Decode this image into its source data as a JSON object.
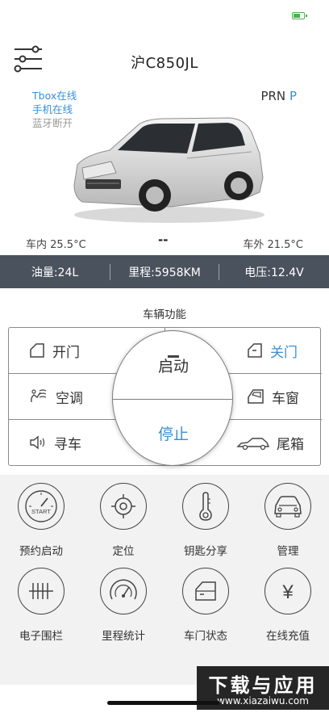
{
  "header": {
    "title": "沪C850JL"
  },
  "connection": {
    "tbox": "Tbox在线",
    "phone": "手机在线",
    "bluetooth": "蓝牙断开"
  },
  "gear": {
    "options": "PRN",
    "active": "P"
  },
  "temperature": {
    "inside": "车内 25.5°C",
    "middle": "--",
    "outside": "车外 21.5°C"
  },
  "info_bar": {
    "fuel": "油量:24L",
    "mileage": "里程:5958KM",
    "voltage": "电压:12.4V"
  },
  "functions": {
    "title": "车辆功能",
    "open_door": "开门",
    "close_door": "关门",
    "ac": "空调",
    "window": "车窗",
    "find_car": "寻车",
    "trunk": "尾箱",
    "start": "启动",
    "stop": "停止"
  },
  "grid": [
    {
      "label": "预约启动",
      "icon": "start-clock-icon",
      "icon_text": "START"
    },
    {
      "label": "定位",
      "icon": "target-icon"
    },
    {
      "label": "钥匙分享",
      "icon": "thermometer-key-icon"
    },
    {
      "label": "管理",
      "icon": "car-front-icon"
    },
    {
      "label": "电子围栏",
      "icon": "fence-icon"
    },
    {
      "label": "里程统计",
      "icon": "speedometer-icon"
    },
    {
      "label": "车门状态",
      "icon": "door-icon"
    },
    {
      "label": "在线充值",
      "icon": "yen-icon",
      "icon_text": "¥"
    }
  ],
  "watermark": {
    "main": "下载与应用",
    "sub": "www.xiazaiwu.com"
  },
  "colors": {
    "accent": "#3a8fd6",
    "info_bar": "#4a535d",
    "battery": "#4caf50"
  }
}
